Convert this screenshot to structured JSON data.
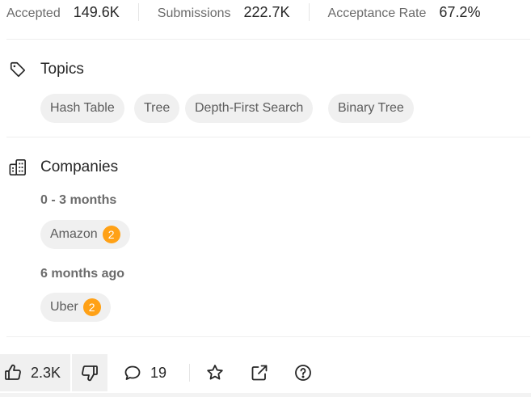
{
  "stats": {
    "accepted_label": "Accepted",
    "accepted_value": "149.6K",
    "submissions_label": "Submissions",
    "submissions_value": "222.7K",
    "acceptance_label": "Acceptance Rate",
    "acceptance_value": "67.2%"
  },
  "topics": {
    "title": "Topics",
    "icon": "tag-icon",
    "items": [
      "Hash Table",
      "Tree",
      "Depth-First Search",
      "Binary Tree"
    ]
  },
  "companies": {
    "title": "Companies",
    "icon": "building-icon",
    "groups": [
      {
        "period": "0 - 3 months",
        "items": [
          {
            "name": "Amazon",
            "count": "2"
          }
        ]
      },
      {
        "period": "6 months ago",
        "items": [
          {
            "name": "Uber",
            "count": "2"
          }
        ]
      }
    ]
  },
  "actions": {
    "likes": "2.3K",
    "comments": "19",
    "icons": [
      "thumbs-up-icon",
      "thumbs-down-icon",
      "comment-icon",
      "star-icon",
      "share-icon",
      "help-icon"
    ]
  },
  "colors": {
    "badge": "#ffa116",
    "chip_bg": "#f0f0f0",
    "text": "#262626",
    "muted": "#6b6b6b"
  }
}
